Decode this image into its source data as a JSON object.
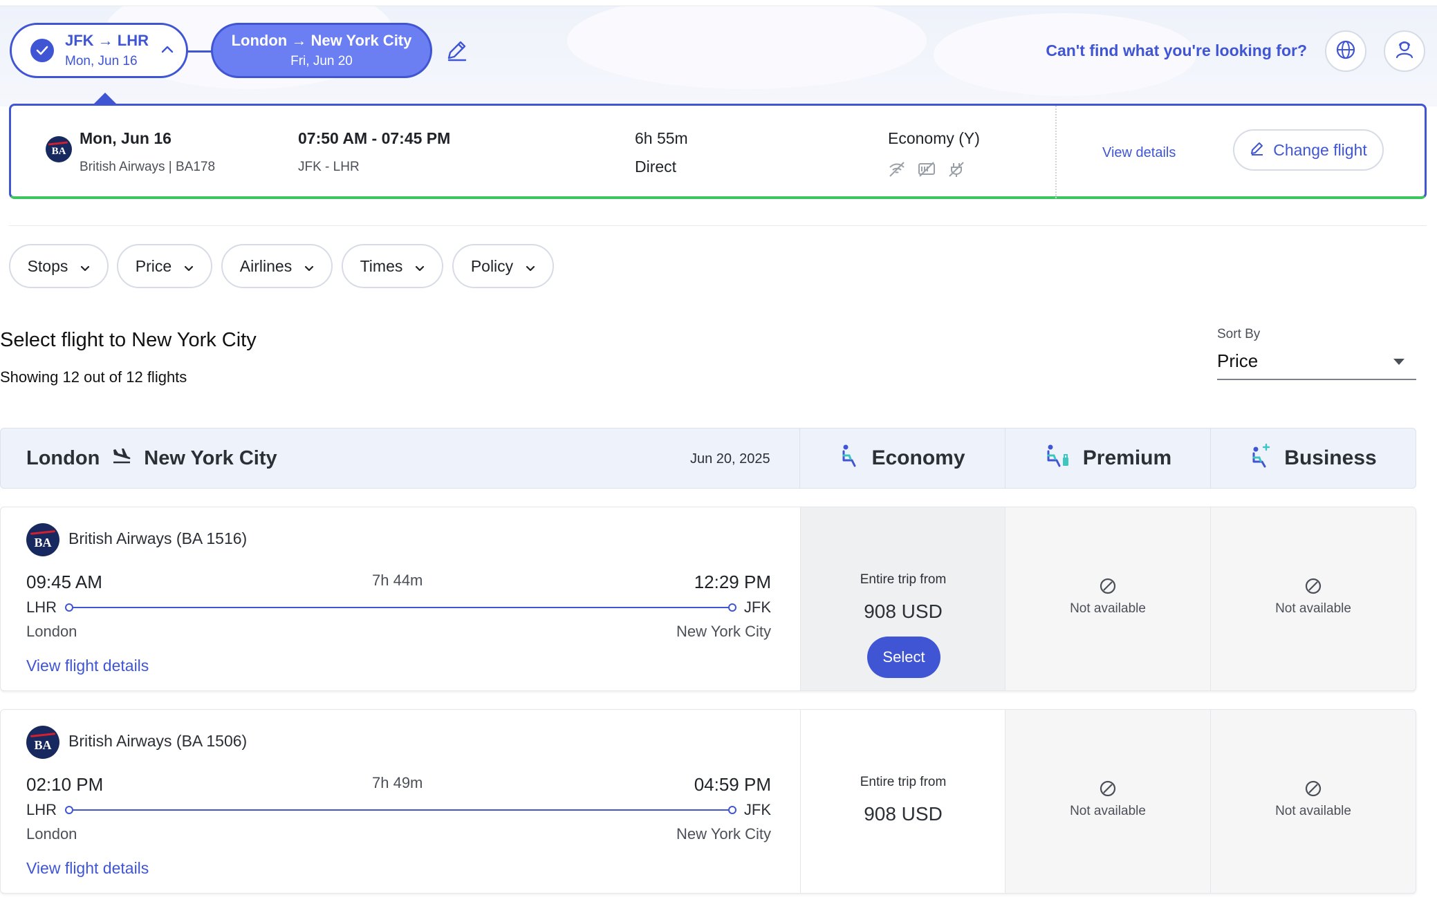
{
  "legs": [
    {
      "route": "JFK → LHR",
      "date": "Mon, Jun 16"
    },
    {
      "route": "London → New York City",
      "date": "Fri, Jun 20"
    }
  ],
  "header": {
    "help_link": "Can't find what you're looking for?"
  },
  "selected_flight": {
    "date": "Mon, Jun 16",
    "airline": "British Airways | BA178",
    "logo_text": "BA",
    "times": "07:50 AM - 07:45 PM",
    "route": "JFK - LHR",
    "duration": "6h 55m",
    "stops": "Direct",
    "cabin": "Economy (Y)",
    "view_details": "View details",
    "change_label": "Change flight"
  },
  "filters": [
    "Stops",
    "Price",
    "Airlines",
    "Times",
    "Policy"
  ],
  "list": {
    "title": "Select flight to New York City",
    "count": "Showing 12 out of 12 flights",
    "sort_label": "Sort By",
    "sort_value": "Price"
  },
  "table_header": {
    "from": "London",
    "to": "New York City",
    "date": "Jun 20, 2025",
    "cabins": [
      "Economy",
      "Premium",
      "Business"
    ]
  },
  "flights": [
    {
      "logo_text": "BA",
      "airline": "British Airways (BA 1516)",
      "dep_time": "09:45 AM",
      "arr_time": "12:29 PM",
      "duration": "7h 44m",
      "from_code": "LHR",
      "to_code": "JFK",
      "from_city": "London",
      "to_city": "New York City",
      "view_details": "View flight details",
      "economy": {
        "label": "Entire trip from",
        "price": "908 USD",
        "select_label": "Select"
      },
      "premium": "Not available",
      "business": "Not available"
    },
    {
      "logo_text": "BA",
      "airline": "British Airways (BA 1506)",
      "dep_time": "02:10 PM",
      "arr_time": "04:59 PM",
      "duration": "7h 49m",
      "from_code": "LHR",
      "to_code": "JFK",
      "from_city": "London",
      "to_city": "New York City",
      "view_details": "View flight details",
      "economy": {
        "label": "Entire trip from",
        "price": "908 USD"
      },
      "premium": "Not available",
      "business": "Not available"
    }
  ],
  "colors": {
    "accent": "#3f55d3",
    "accent_light": "#6b7ef2",
    "success": "#3dc65f",
    "header_bg": "#eef2fa"
  }
}
